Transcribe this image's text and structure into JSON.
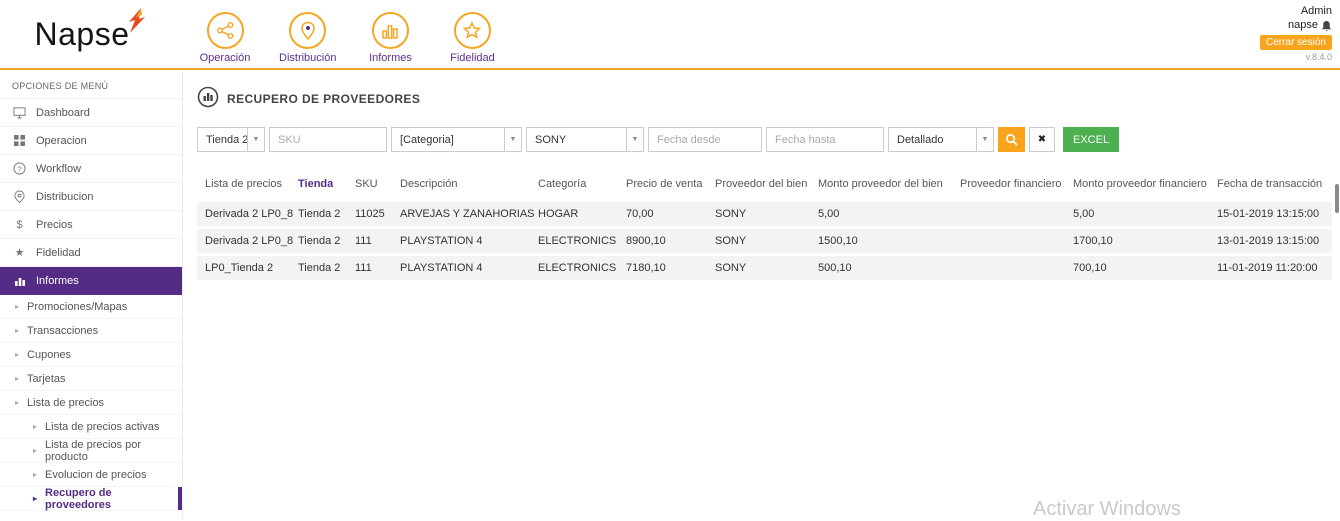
{
  "icons": {
    "chevron": "▼",
    "caret": "▸",
    "clear": "✖",
    "star": "★",
    "dollar": "$",
    "question": "?"
  },
  "header": {
    "logo": "Napse",
    "nav": [
      {
        "label": "Operación"
      },
      {
        "label": "Distribución"
      },
      {
        "label": "Informes"
      },
      {
        "label": "Fidelidad"
      }
    ],
    "user_line1": "Admin",
    "user_line2": "napse",
    "logout": "Cerrar sesión",
    "version": "v.8.4.0"
  },
  "sidebar": {
    "caption": "OPCIONES DE MENÚ",
    "items": [
      {
        "label": "Dashboard"
      },
      {
        "label": "Operacion"
      },
      {
        "label": "Workflow"
      },
      {
        "label": "Distribucion"
      },
      {
        "label": "Precios"
      },
      {
        "label": "Fidelidad"
      },
      {
        "label": "Informes"
      }
    ],
    "subitems": [
      {
        "label": "Promociones/Mapas"
      },
      {
        "label": "Transacciones"
      },
      {
        "label": "Cupones"
      },
      {
        "label": "Tarjetas"
      },
      {
        "label": "Lista de precios"
      }
    ],
    "subsubitems": [
      {
        "label": "Lista de precios activas"
      },
      {
        "label": "Lista de precios por producto"
      },
      {
        "label": "Evolucion de precios"
      },
      {
        "label": "Recupero de proveedores"
      }
    ]
  },
  "main": {
    "title": "RECUPERO DE PROVEEDORES",
    "filters": {
      "store_value": "Tienda 2",
      "sku_placeholder": "SKU",
      "category_value": "[Categoria]",
      "provider_value": "SONY",
      "date_from_placeholder": "Fecha desde",
      "date_to_placeholder": "Fecha hasta",
      "detail_value": "Detallado",
      "excel_label": "EXCEL"
    },
    "table": {
      "columns": [
        "Lista de precios",
        "Tienda",
        "SKU",
        "Descripción",
        "Categoría",
        "Precio de venta",
        "Proveedor del bien",
        "Monto proveedor del bien",
        "Proveedor financiero",
        "Monto proveedor financiero",
        "Fecha de transacción"
      ],
      "rows": [
        [
          "Derivada 2 LP0_8",
          "Tienda 2",
          "11025",
          "ARVEJAS Y ZANAHORIAS",
          "HOGAR",
          "70,00",
          "SONY",
          "5,00",
          "",
          "5,00",
          "15-01-2019 13:15:00"
        ],
        [
          "Derivada 2 LP0_8",
          "Tienda 2",
          "111",
          "PLAYSTATION 4",
          "ELECTRONICS",
          "8900,10",
          "SONY",
          "1500,10",
          "",
          "1700,10",
          "13-01-2019 13:15:00"
        ],
        [
          "LP0_Tienda 2",
          "Tienda 2",
          "111",
          "PLAYSTATION 4",
          "ELECTRONICS",
          "7180,10",
          "SONY",
          "500,10",
          "",
          "700,10",
          "11-01-2019 11:20:00"
        ]
      ]
    }
  },
  "watermark": "Activar Windows",
  "colors": {
    "purple": "#542c85",
    "orange": "#f5a623",
    "header_border": "#f0a32e",
    "logout_orange": "#f8a51d",
    "excel_green": "#4caf50"
  }
}
